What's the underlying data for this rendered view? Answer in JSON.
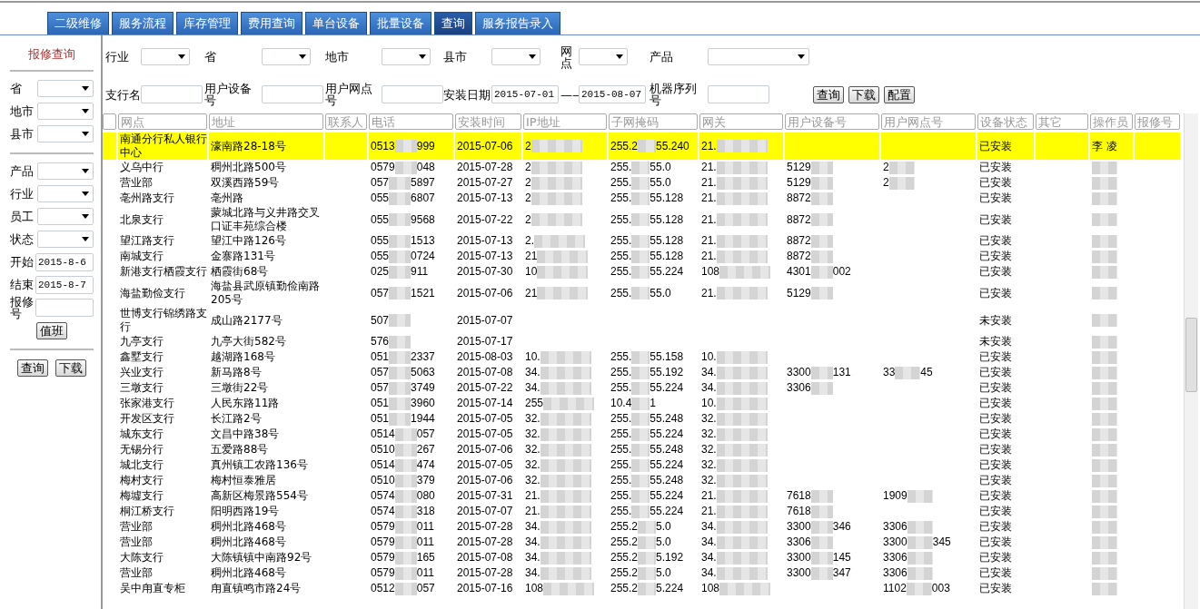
{
  "nav_tabs": [
    {
      "label": "二级维修",
      "selected": false
    },
    {
      "label": "服务流程",
      "selected": false
    },
    {
      "label": "库存管理",
      "selected": false
    },
    {
      "label": "费用查询",
      "selected": false
    },
    {
      "label": "单台设备",
      "selected": false
    },
    {
      "label": "批量设备",
      "selected": false
    },
    {
      "label": "查询",
      "selected": true
    },
    {
      "label": "服务报告录入",
      "selected": false
    }
  ],
  "sidebar": {
    "title": "报修查询",
    "region_fields": [
      {
        "label": "省",
        "kind": "select"
      },
      {
        "label": "地市",
        "kind": "select"
      },
      {
        "label": "县市",
        "kind": "select"
      }
    ],
    "filter_fields": [
      {
        "label": "产品",
        "kind": "select"
      },
      {
        "label": "行业",
        "kind": "select"
      },
      {
        "label": "员工",
        "kind": "select"
      },
      {
        "label": "状态",
        "kind": "select"
      },
      {
        "label": "开始",
        "kind": "text",
        "value": "2015-8-6"
      },
      {
        "label": "结束",
        "kind": "text",
        "value": "2015-8-7"
      },
      {
        "label": "报修号",
        "kind": "text"
      }
    ],
    "duty_button": "值班",
    "buttons": [
      "查询",
      "下载"
    ]
  },
  "filter": {
    "rows": [
      [
        {
          "label": "行业",
          "kind": "select"
        },
        {
          "label": "省",
          "kind": "select"
        },
        {
          "label": "地市",
          "kind": "select"
        },
        {
          "label": "县市",
          "kind": "select"
        },
        {
          "label": "网点",
          "kind": "select"
        },
        {
          "label": "产品",
          "kind": "select"
        }
      ],
      [
        {
          "label": "支行名",
          "kind": "text"
        },
        {
          "label": "用户设备号",
          "kind": "text"
        },
        {
          "label": "用户网点号",
          "kind": "text"
        },
        {
          "label": "安装日期",
          "kind": "text",
          "value": "2015-07-01"
        },
        {
          "label": "——",
          "kind": "text",
          "value": "2015-08-07"
        },
        {
          "label": "机器序列号",
          "kind": "text"
        }
      ]
    ],
    "buttons": [
      "查询",
      "下载",
      "配置"
    ]
  },
  "table": {
    "columns": [
      "网点",
      "地址",
      "联系人",
      "电话",
      "安装时间",
      "IP地址",
      "子网掩码",
      "网关",
      "用户设备号",
      "用户网点号",
      "设备状态",
      "其它",
      "操作员",
      "报修号"
    ],
    "rows": [
      {
        "selected": true,
        "site": "南通分行私人银行中心",
        "address": "濠南路28-18号",
        "phone": [
          "0513",
          "999"
        ],
        "date": "2015-07-06",
        "ip": "2",
        "mask": [
          "255.2",
          "55.240"
        ],
        "gateway": "21.",
        "status": "已安装",
        "operator": "李 凌"
      },
      {
        "selected": false,
        "site": "义乌中行",
        "address": "稠州北路500号",
        "phone": [
          "0579",
          "048"
        ],
        "date": "2015-07-28",
        "ip": "2",
        "mask": [
          "255.",
          "55.0"
        ],
        "gateway": "21.",
        "device_no": [
          "5129"
        ],
        "site_no": [
          "2"
        ],
        "status": "已安装"
      },
      {
        "selected": false,
        "site": "营业部",
        "address": "双溪西路59号",
        "phone": [
          "057",
          "5897"
        ],
        "date": "2015-07-27",
        "ip": "2",
        "mask": [
          "255.",
          "55.0"
        ],
        "gateway": "21.",
        "device_no": [
          "5129"
        ],
        "site_no": [
          "2"
        ],
        "status": "已安装"
      },
      {
        "selected": false,
        "site": "亳州路支行",
        "address": "亳州路",
        "phone": [
          "055",
          "6807"
        ],
        "date": "2015-07-13",
        "ip": "2",
        "mask": [
          "255.",
          "55.128"
        ],
        "gateway": "21.",
        "device_no": [
          "8872"
        ],
        "status": "已安装"
      },
      {
        "selected": false,
        "site": "北泉支行",
        "address": "蒙城北路与义井路交叉口证丰苑综合楼",
        "phone": [
          "055",
          "9568"
        ],
        "date": "2015-07-22",
        "ip": "2",
        "mask": [
          "255.",
          "55.128"
        ],
        "gateway": "21.",
        "device_no": [
          "8872"
        ],
        "status": "已安装"
      },
      {
        "selected": false,
        "site": "望江路支行",
        "address": "望江中路126号",
        "phone": [
          "055",
          "1513"
        ],
        "date": "2015-07-13",
        "ip": "2.",
        "mask": [
          "255.",
          "55.128"
        ],
        "gateway": "21.",
        "device_no": [
          "8872"
        ],
        "status": "已安装"
      },
      {
        "selected": false,
        "site": "南城支行",
        "address": "金寨路131号",
        "phone": [
          "055",
          "0724"
        ],
        "date": "2015-07-13",
        "ip": "21",
        "mask": [
          "255.",
          "55.128"
        ],
        "gateway": "21.",
        "device_no": [
          "8872"
        ],
        "status": "已安装"
      },
      {
        "selected": false,
        "site": "新港支行栖霞支行",
        "address": "栖霞街68号",
        "phone": [
          "025",
          "911"
        ],
        "date": "2015-07-30",
        "ip": "10",
        "mask": [
          "255.",
          "55.224"
        ],
        "gateway": "108",
        "device_no": [
          "4301",
          "002"
        ],
        "status": "已安装"
      },
      {
        "selected": false,
        "site": "海盐勤俭支行",
        "address": "海盐县武原镇勤俭南路205号",
        "phone": [
          "057",
          "1521"
        ],
        "date": "2015-07-06",
        "ip": "21",
        "mask": [
          "255.",
          "55.0"
        ],
        "gateway": "21.",
        "device_no": [
          "5129"
        ],
        "status": "已安装"
      },
      {
        "selected": false,
        "site": "世博支行锦绣路支行",
        "address": "成山路2177号",
        "phone": [
          "507"
        ],
        "date": "2015-07-07",
        "status": "未安装"
      },
      {
        "selected": false,
        "site": "九亭支行",
        "address": "九亭大街582号",
        "phone": [
          "576"
        ],
        "date": "2015-07-17",
        "status": "未安装"
      },
      {
        "selected": false,
        "site": "鑫墅支行",
        "address": "越湖路168号",
        "phone": [
          "051",
          "2337"
        ],
        "date": "2015-08-03",
        "ip": "10.",
        "mask": [
          "255.",
          "55.158"
        ],
        "gateway": "10.",
        "status": "已安装"
      },
      {
        "selected": false,
        "site": "兴业支行",
        "address": "新马路8号",
        "phone": [
          "057",
          "5063"
        ],
        "date": "2015-07-08",
        "ip": "34.",
        "mask": [
          "255.",
          "55.192"
        ],
        "gateway": "34.",
        "device_no": [
          "3300",
          "131"
        ],
        "site_no": [
          "33",
          "45"
        ],
        "status": "已安装"
      },
      {
        "selected": false,
        "site": "三墩支行",
        "address": "三墩街22号",
        "phone": [
          "057",
          "3749"
        ],
        "date": "2015-07-22",
        "ip": "34.",
        "mask": [
          "255.",
          "55.224"
        ],
        "gateway": "34.",
        "device_no": [
          "3306"
        ],
        "status": "已安装"
      },
      {
        "selected": false,
        "site": "张家港支行",
        "address": "人民东路11路",
        "phone": [
          "051",
          "3960"
        ],
        "date": "2015-07-14",
        "ip": "255",
        "mask": [
          "10.4",
          "1"
        ],
        "gateway": "10.",
        "status": "已安装"
      },
      {
        "selected": false,
        "site": "开发区支行",
        "address": "长江路2号",
        "phone": [
          "051",
          "1944"
        ],
        "date": "2015-07-05",
        "ip": "32.",
        "mask": [
          "255.",
          "55.248"
        ],
        "gateway": "32.",
        "status": "已安装"
      },
      {
        "selected": false,
        "site": "城东支行",
        "address": "文昌中路38号",
        "phone": [
          "0514",
          "057"
        ],
        "date": "2015-07-05",
        "ip": "32.",
        "mask": [
          "255.",
          "55.224"
        ],
        "gateway": "32.",
        "status": "已安装"
      },
      {
        "selected": false,
        "site": "无锡分行",
        "address": "五爱路88号",
        "phone": [
          "0510",
          "267"
        ],
        "date": "2015-07-06",
        "ip": "32.",
        "mask": [
          "255.",
          "55.248"
        ],
        "gateway": "32.",
        "status": "已安装"
      },
      {
        "selected": false,
        "site": "城北支行",
        "address": "真州镇工农路136号",
        "phone": [
          "0514",
          "474"
        ],
        "date": "2015-07-05",
        "ip": "32.",
        "mask": [
          "255.",
          "55.224"
        ],
        "gateway": "32.",
        "status": "已安装"
      },
      {
        "selected": false,
        "site": "梅村支行",
        "address": "梅村恒泰雅居",
        "phone": [
          "0510",
          "379"
        ],
        "date": "2015-07-06",
        "ip": "32.",
        "mask": [
          "255.",
          "55.248"
        ],
        "gateway": "32.",
        "status": "已安装"
      },
      {
        "selected": false,
        "site": "梅墟支行",
        "address": "高新区梅景路554号",
        "phone": [
          "0574",
          "080"
        ],
        "date": "2015-07-31",
        "ip": "21.",
        "mask": [
          "255.",
          "55.224"
        ],
        "gateway": "21.",
        "device_no": [
          "7618"
        ],
        "site_no": [
          "1909"
        ],
        "status": "已安装"
      },
      {
        "selected": false,
        "site": "桐江桥支行",
        "address": "阳明西路19号",
        "phone": [
          "0574",
          "318"
        ],
        "date": "2015-07-07",
        "ip": "21.",
        "mask": [
          "255.",
          "55.224"
        ],
        "gateway": "21.",
        "device_no": [
          "7618"
        ],
        "status": "已安装"
      },
      {
        "selected": false,
        "site": "营业部",
        "address": "稠州北路468号",
        "phone": [
          "0579",
          "011"
        ],
        "date": "2015-07-28",
        "ip": "34.",
        "mask": [
          "255.2",
          "5.0"
        ],
        "gateway": "34.",
        "device_no": [
          "3300",
          "346"
        ],
        "site_no": [
          "3306"
        ],
        "status": "已安装"
      },
      {
        "selected": false,
        "site": "营业部",
        "address": "稠州北路468号",
        "phone": [
          "0579",
          "011"
        ],
        "date": "2015-07-28",
        "ip": "34.",
        "mask": [
          "255.2",
          "5.0"
        ],
        "gateway": "34.",
        "device_no": [
          "3306"
        ],
        "site_no": [
          "3300",
          "345"
        ],
        "status": "已安装"
      },
      {
        "selected": false,
        "site": "大陈支行",
        "address": "大陈镇镇中南路92号",
        "phone": [
          "0579",
          "165"
        ],
        "date": "2015-07-08",
        "ip": "34.",
        "mask": [
          "255.2",
          "5.192"
        ],
        "gateway": "34.",
        "device_no": [
          "3300",
          "145"
        ],
        "site_no": [
          "3306"
        ],
        "status": "已安装"
      },
      {
        "selected": false,
        "site": "营业部",
        "address": "稠州北路468号",
        "phone": [
          "0579",
          "011"
        ],
        "date": "2015-07-28",
        "ip": "34.",
        "mask": [
          "255.2",
          "5.0"
        ],
        "gateway": "34.",
        "device_no": [
          "3300",
          "347"
        ],
        "site_no": [
          "3306"
        ],
        "status": "已安装"
      },
      {
        "selected": false,
        "site": "吴中甪直专柜",
        "address": "甪直镇鸣市路24号",
        "phone": [
          "0512",
          "057"
        ],
        "date": "2015-07-16",
        "ip": "108",
        "mask": [
          "255.2",
          "5.224"
        ],
        "gateway": "108",
        "site_no": [
          "1102",
          "003"
        ],
        "status": "已安装"
      }
    ]
  }
}
